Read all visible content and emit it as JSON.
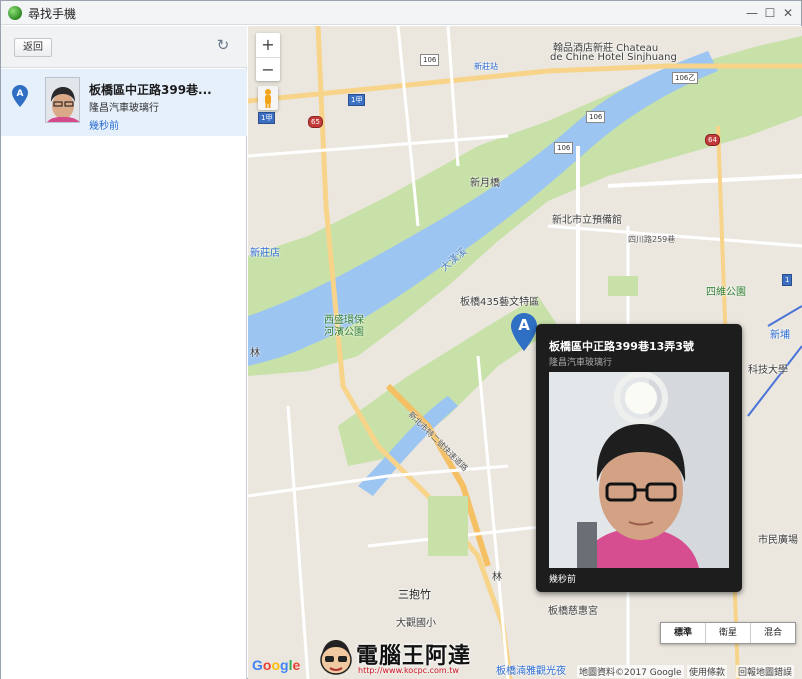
{
  "window": {
    "title": "尋找手機"
  },
  "sidebar": {
    "back_label": "返回",
    "device": {
      "name": "板橋區中正路399巷...",
      "subtitle": "隆昌汽車玻璃行",
      "time": "幾秒前",
      "marker_letter": "A"
    }
  },
  "map": {
    "marker_letter": "A",
    "zoom_in": "+",
    "zoom_out": "−",
    "labels": {
      "hotel": "翰品酒店新莊 Chateau",
      "hotel2": "de Chine Hotel Sinjhuang",
      "xinzhuang_station": "新莊站",
      "xinzhuang_store": "新莊店",
      "xinyue_bridge": "新月橋",
      "library": "新北市立預備館",
      "art": "板橋435藝文特區",
      "park": "西盛環保",
      "park2": "河濱公園",
      "river": "大漢溪",
      "sida_park": "四維公園",
      "tech_univ": "科技大學",
      "sanbao": "三抱竹",
      "dagui": "大觀國小",
      "huilin": "板橋慈惠宮",
      "plaza": "市民廣場",
      "expressway": "新北市特二號快速道路",
      "lane259": "四川路259巷",
      "bridge_label": "板橋湳雅觀光夜",
      "lin": "林",
      "xinfu_station": "新埔",
      "lin2": "林"
    },
    "roads": {
      "r106": "106",
      "r106b": "106乙",
      "r1jia": "1甲",
      "r65": "65",
      "r64": "64",
      "r1": "1"
    },
    "info": {
      "title": "板橋區中正路399巷13弄3號",
      "subtitle": "隆昌汽車玻璃行",
      "time": "幾秒前"
    },
    "map_types": [
      "標準",
      "衛星",
      "混合"
    ],
    "google": "Google",
    "attribution": "地圖資料©2017 Google",
    "terms": "使用條款",
    "report": "回報地圖錯誤"
  },
  "watermark": {
    "text": "電腦王阿達",
    "url": "http://www.kocpc.com.tw"
  }
}
